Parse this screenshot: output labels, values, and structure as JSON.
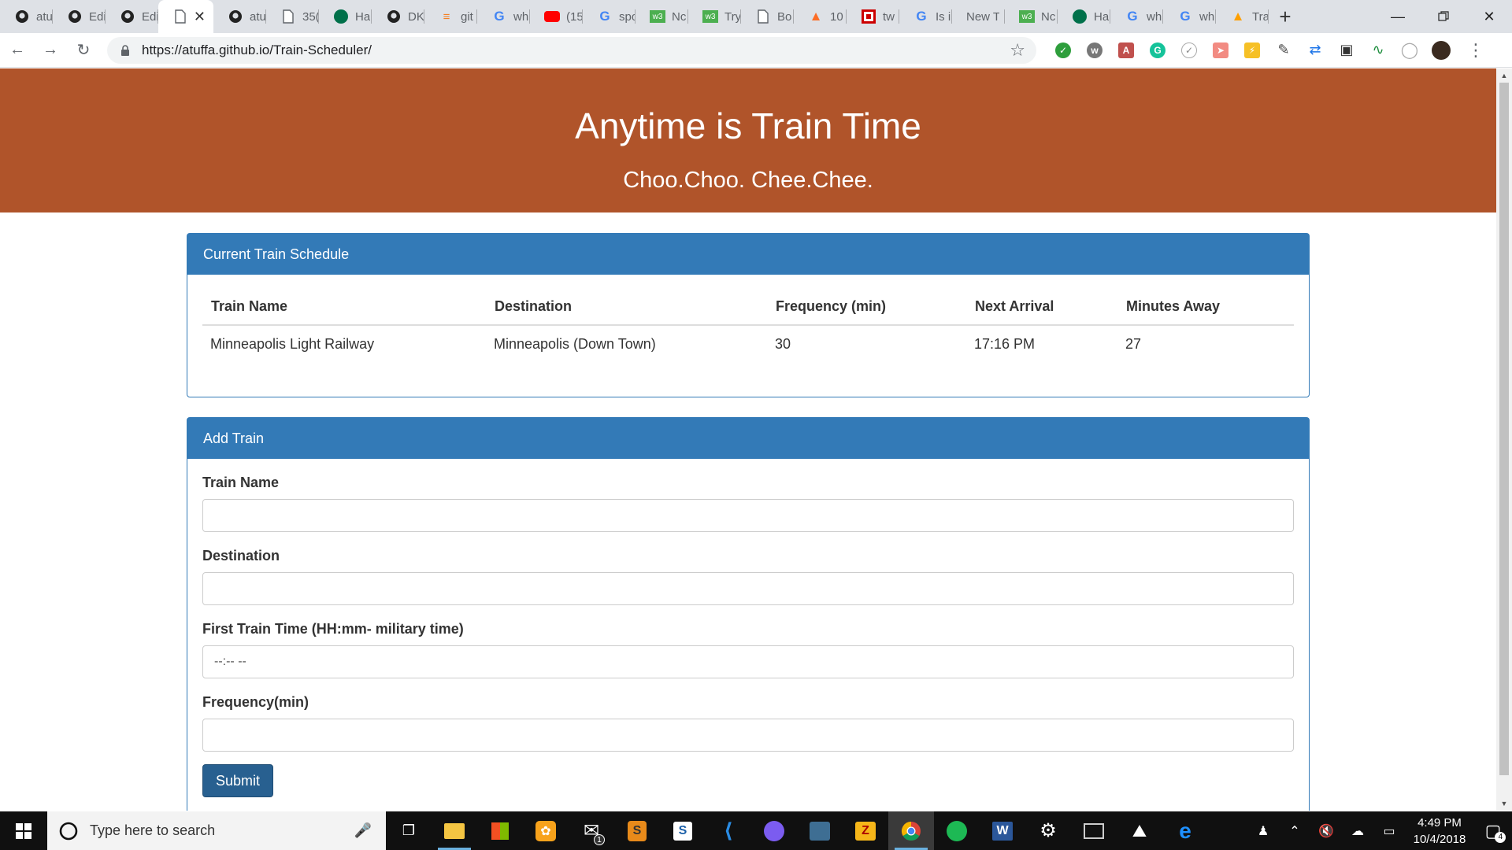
{
  "browser": {
    "tabs": [
      {
        "icon": "github-icon",
        "title": "atu"
      },
      {
        "icon": "github-icon",
        "title": "Edi"
      },
      {
        "icon": "github-icon",
        "title": "Edi"
      },
      {
        "icon": "page-icon",
        "title": "",
        "active": true
      },
      {
        "icon": "github-icon",
        "title": "atu"
      },
      {
        "icon": "page-icon",
        "title": "35("
      },
      {
        "icon": "starbucks-icon",
        "title": "Ha"
      },
      {
        "icon": "github-icon",
        "title": "DK"
      },
      {
        "icon": "stackoverflow-icon",
        "title": "git"
      },
      {
        "icon": "google-icon",
        "title": "wh"
      },
      {
        "icon": "youtube-icon",
        "title": "(15"
      },
      {
        "icon": "google-icon",
        "title": "spo"
      },
      {
        "icon": "w3schools-icon",
        "title": "Nc"
      },
      {
        "icon": "w3schools-icon",
        "title": "Try"
      },
      {
        "icon": "page-icon",
        "title": "Bo"
      },
      {
        "icon": "gitlab-icon",
        "title": "10"
      },
      {
        "icon": "trello-icon",
        "title": "tw"
      },
      {
        "icon": "google-icon",
        "title": "Is i"
      },
      {
        "icon": "none",
        "title": "New Ta"
      },
      {
        "icon": "w3schools-icon",
        "title": "Nc"
      },
      {
        "icon": "starbucks-icon",
        "title": "Ha"
      },
      {
        "icon": "google-icon",
        "title": "wh"
      },
      {
        "icon": "google-icon",
        "title": "wh"
      },
      {
        "icon": "firebase-icon",
        "title": "Tra"
      }
    ],
    "url": "https://atuffa.github.io/Train-Scheduler/"
  },
  "page": {
    "title": "Anytime is Train Time",
    "subtitle": "Choo.Choo. Chee.Chee.",
    "schedule": {
      "heading": "Current Train Schedule",
      "columns": [
        "Train Name",
        "Destination",
        "Frequency (min)",
        "Next Arrival",
        "Minutes Away"
      ],
      "rows": [
        [
          "Minneapolis Light Railway",
          "Minneapolis (Down Town)",
          "30",
          "17:16 PM",
          "27"
        ]
      ]
    },
    "form": {
      "heading": "Add Train",
      "train_name_label": "Train Name",
      "train_name_value": "",
      "destination_label": "Destination",
      "destination_value": "",
      "first_time_label": "First Train Time (HH:mm- military time)",
      "first_time_placeholder": "--:-- --",
      "frequency_label": "Frequency(min)",
      "frequency_value": "",
      "submit_label": "Submit"
    }
  },
  "taskbar": {
    "search_placeholder": "Type here to search",
    "mail_badge": "1",
    "time": "4:49 PM",
    "date": "10/4/2018",
    "notification_count": "4"
  },
  "colors": {
    "jumbotron": "#b0542a",
    "panel_primary": "#337ab7",
    "button_primary": "#286090"
  }
}
